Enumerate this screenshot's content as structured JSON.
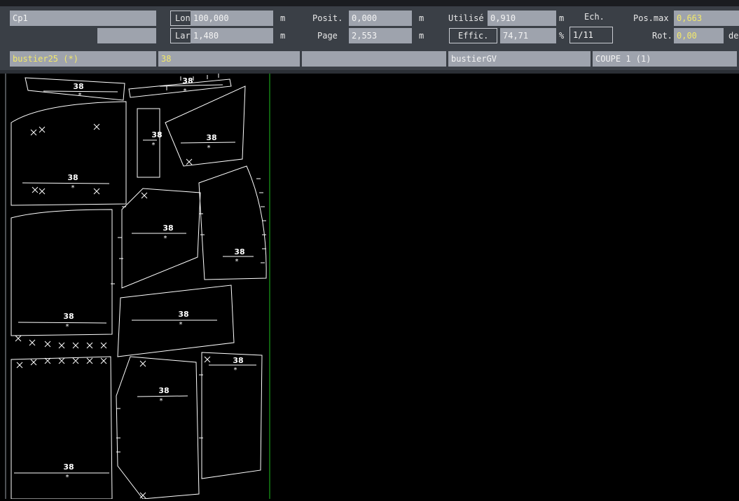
{
  "toolbar": {
    "placement_name": "Cp1",
    "long_label": "Long.",
    "long_value": "100,000",
    "long_unit": "m",
    "larg_label": "Larg.",
    "larg_value": "1,480",
    "larg_unit": "m",
    "posit_label": "Posit.",
    "posit_value": "0,000",
    "posit_unit": "m",
    "page_label": "Page",
    "page_value": "2,553",
    "page_unit": "m",
    "utilise_label": "Utilisé",
    "utilise_value": "0,910",
    "utilise_unit": "m",
    "effic_label": "Effic.",
    "effic_value": "74,71",
    "effic_unit": "%",
    "ech_label": "Ech.",
    "ech_value": "1/11",
    "posmax_label": "Pos.max",
    "posmax_value": "0,663",
    "rot_label": "Rot.",
    "rot_value": "0,00",
    "rot_unit": "de"
  },
  "status": {
    "model_name": "bustier25 (*)",
    "size": "38",
    "field3": "",
    "variant": "bustierGV",
    "cut": "COUPE 1 (1)"
  },
  "pieces": {
    "size_label": "38",
    "marker": "*"
  },
  "colors": {
    "background": "#000000",
    "panel": "#3a3f46",
    "field": "#9ea3ad",
    "highlight_text": "#f2e86a",
    "piece_outline": "#ffffff",
    "limit_line": "#20c020"
  }
}
